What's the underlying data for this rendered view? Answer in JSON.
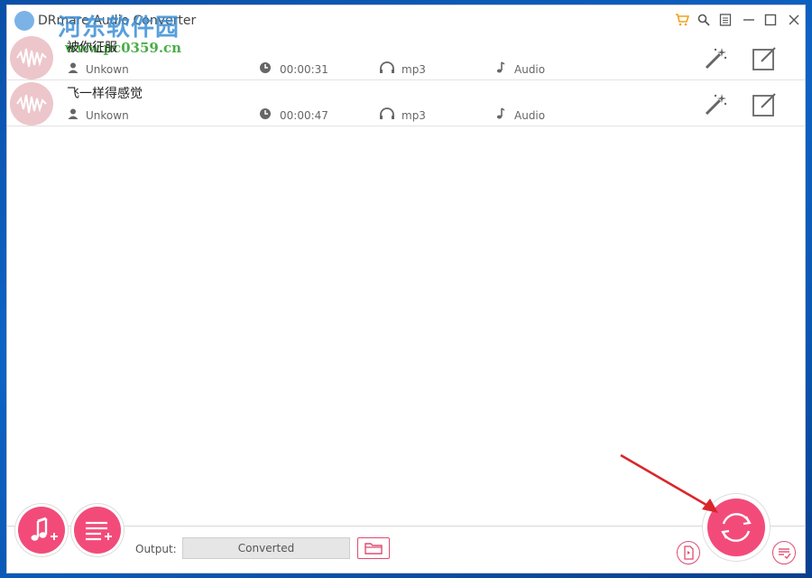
{
  "app": {
    "title": "DRmare Audio Converter"
  },
  "watermark": {
    "text": "河东软件园",
    "url": "www.pc0359.cn"
  },
  "titlebar": {
    "icons": [
      "cart-icon",
      "search-icon",
      "menu-icon",
      "minimize-icon",
      "maximize-icon",
      "close-icon"
    ]
  },
  "files": [
    {
      "title": "被你征服",
      "artist": "Unkown",
      "duration": "00:00:31",
      "format": "mp3",
      "type": "Audio"
    },
    {
      "title": "飞一样得感觉",
      "artist": "Unkown",
      "duration": "00:00:47",
      "format": "mp3",
      "type": "Audio"
    }
  ],
  "footer": {
    "output_label": "Output:",
    "output_value": "Converted"
  },
  "colors": {
    "accent": "#f24b7a",
    "thumb": "#ecc6cb",
    "desktop": "#0d63c4",
    "arrow": "#d9262c"
  }
}
